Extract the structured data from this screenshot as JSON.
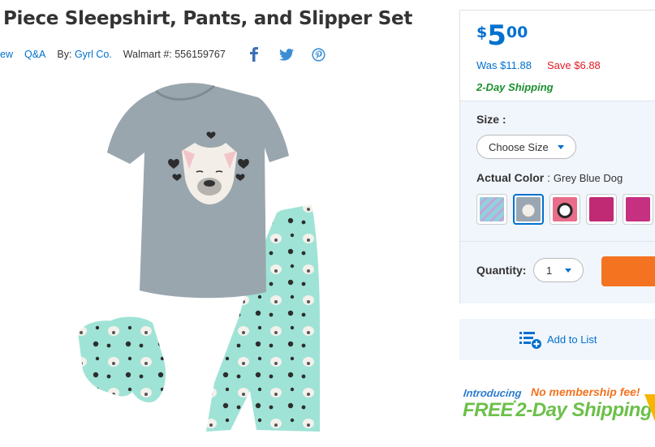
{
  "product": {
    "title": "Piece Sleepshirt, Pants, and Slipper Set",
    "review_link": "ew",
    "qa_link": "Q&A",
    "by_label": "By:",
    "brand": "Gyrl Co.",
    "walmart_label": "Walmart #:",
    "walmart_number": "556159767"
  },
  "social": [
    "facebook-icon",
    "twitter-icon",
    "pinterest-icon"
  ],
  "price": {
    "currency": "$",
    "whole": "5",
    "cents": "00",
    "was": "Was $11.88",
    "save": "Save $6.88",
    "shipping": "2-Day Shipping"
  },
  "options": {
    "size_label": "Size :",
    "size_value": "Choose Size",
    "color_label": "Actual Color",
    "color_value": "Grey Blue Dog",
    "swatches": [
      "#8fd3d8",
      "#9aa7b2",
      "#e86d8a",
      "#c02a74",
      "#c53080"
    ],
    "quantity_label": "Quantity:",
    "quantity_value": "1"
  },
  "list": {
    "label": "Add to List"
  },
  "promo": {
    "intro": "Introducing",
    "nofee": "No membership fee!",
    "free": "FREE",
    "ship": "2-Day Shipping"
  },
  "colors": {
    "accent": "#0071ce",
    "save": "#de1c24",
    "add_button": "#f47321",
    "ship_green": "#1a8f2e"
  }
}
